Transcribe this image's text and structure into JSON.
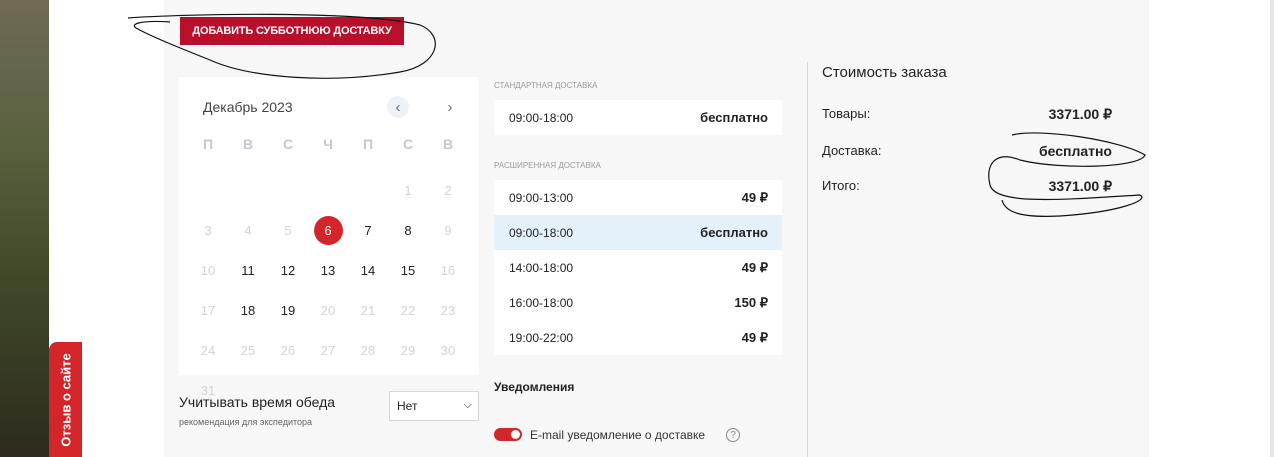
{
  "sidebar_tab": {
    "label": "Отзыв о сайте"
  },
  "saturday_button": {
    "label": "ДОБАВИТЬ СУББОТНЮЮ ДОСТАВКУ"
  },
  "calendar": {
    "month": "Декабрь 2023",
    "prev_icon": "chevron-left-icon",
    "next_icon": "chevron-right-icon",
    "weekdays": [
      "П",
      "В",
      "С",
      "Ч",
      "П",
      "С",
      "В"
    ],
    "leading_blanks": 5,
    "days": [
      {
        "day": "1",
        "state": "disabled"
      },
      {
        "day": "2",
        "state": "disabled"
      },
      {
        "day": "3",
        "state": "disabled"
      },
      {
        "day": "4",
        "state": "disabled"
      },
      {
        "day": "5",
        "state": "disabled"
      },
      {
        "day": "6",
        "state": "selected"
      },
      {
        "day": "7",
        "state": "available"
      },
      {
        "day": "8",
        "state": "available"
      },
      {
        "day": "9",
        "state": "disabled"
      },
      {
        "day": "10",
        "state": "disabled"
      },
      {
        "day": "11",
        "state": "available"
      },
      {
        "day": "12",
        "state": "available"
      },
      {
        "day": "13",
        "state": "available"
      },
      {
        "day": "14",
        "state": "available"
      },
      {
        "day": "15",
        "state": "available"
      },
      {
        "day": "16",
        "state": "disabled"
      },
      {
        "day": "17",
        "state": "disabled"
      },
      {
        "day": "18",
        "state": "available"
      },
      {
        "day": "19",
        "state": "available"
      },
      {
        "day": "20",
        "state": "disabled"
      },
      {
        "day": "21",
        "state": "disabled"
      },
      {
        "day": "22",
        "state": "disabled"
      },
      {
        "day": "23",
        "state": "disabled"
      },
      {
        "day": "24",
        "state": "disabled"
      },
      {
        "day": "25",
        "state": "disabled"
      },
      {
        "day": "26",
        "state": "disabled"
      },
      {
        "day": "27",
        "state": "disabled"
      },
      {
        "day": "28",
        "state": "disabled"
      },
      {
        "day": "29",
        "state": "disabled"
      },
      {
        "day": "30",
        "state": "disabled"
      },
      {
        "day": "31",
        "state": "disabled"
      }
    ]
  },
  "lunch": {
    "label": "Учитывать время обеда",
    "hint": "рекомендация для экспедитора",
    "selected": "Нет"
  },
  "standard_delivery": {
    "title": "СТАНДАРТНАЯ ДОСТАВКА",
    "slots": [
      {
        "time": "09:00-18:00",
        "price": "бесплатно",
        "active": false
      }
    ]
  },
  "extended_delivery": {
    "title": "РАСШИРЕННАЯ ДОСТАВКА",
    "slots": [
      {
        "time": "09:00-13:00",
        "price": "49 ₽",
        "active": false
      },
      {
        "time": "09:00-18:00",
        "price": "бесплатно",
        "active": true
      },
      {
        "time": "14:00-18:00",
        "price": "49 ₽",
        "active": false
      },
      {
        "time": "16:00-18:00",
        "price": "150 ₽",
        "active": false
      },
      {
        "time": "19:00-22:00",
        "price": "49 ₽",
        "active": false
      }
    ]
  },
  "notifications": {
    "title": "Уведомления",
    "email_label": "E-mail уведомление о доставке",
    "email_enabled": true,
    "help_icon": "question-circle-icon"
  },
  "summary": {
    "title": "Стоимость заказа",
    "rows": [
      {
        "label": "Товары:",
        "value": "3371.00 ₽"
      },
      {
        "label": "Доставка:",
        "value": "бесплатно"
      },
      {
        "label": "Итого:",
        "value": "3371.00 ₽"
      }
    ]
  },
  "colors": {
    "accent_red": "#d3262b",
    "button_red": "#b8102a",
    "selected_slot": "#e4f1fb",
    "panel_bg": "#f7f7f7"
  }
}
